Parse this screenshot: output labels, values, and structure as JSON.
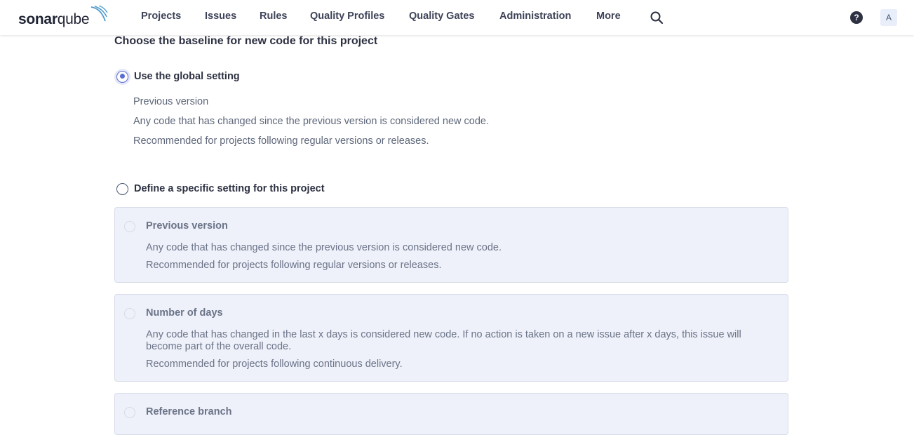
{
  "app": {
    "logo_prefix": "sonar",
    "logo_suffix": "qube",
    "accent_color": "#5d6cd0",
    "logo_wave_color": "#4e9bcd"
  },
  "nav": {
    "items": [
      {
        "label": "Projects"
      },
      {
        "label": "Issues"
      },
      {
        "label": "Rules"
      },
      {
        "label": "Quality Profiles"
      },
      {
        "label": "Quality Gates"
      },
      {
        "label": "Administration"
      },
      {
        "label": "More"
      }
    ],
    "search_icon": "search-icon",
    "help_icon": "help-icon",
    "help_glyph": "?",
    "avatar_letter": "A"
  },
  "main": {
    "title": "Choose the baseline for new code for this project",
    "global_option": {
      "label": "Use the global setting",
      "selected": true,
      "subhead": "Previous version",
      "line1": "Any code that has changed since the previous version is considered new code.",
      "line2": "Recommended for projects following regular versions or releases."
    },
    "specific_option": {
      "label": "Define a specific setting for this project",
      "selected": false
    },
    "cards": [
      {
        "title": "Previous version",
        "line1": "Any code that has changed since the previous version is considered new code.",
        "line2": "Recommended for projects following regular versions or releases."
      },
      {
        "title": "Number of days",
        "line1": "Any code that has changed in the last x days is considered new code. If no action is taken on a new issue after x days, this issue will become part of the overall code.",
        "line2": "Recommended for projects following continuous delivery."
      },
      {
        "title": "Reference branch"
      }
    ]
  }
}
